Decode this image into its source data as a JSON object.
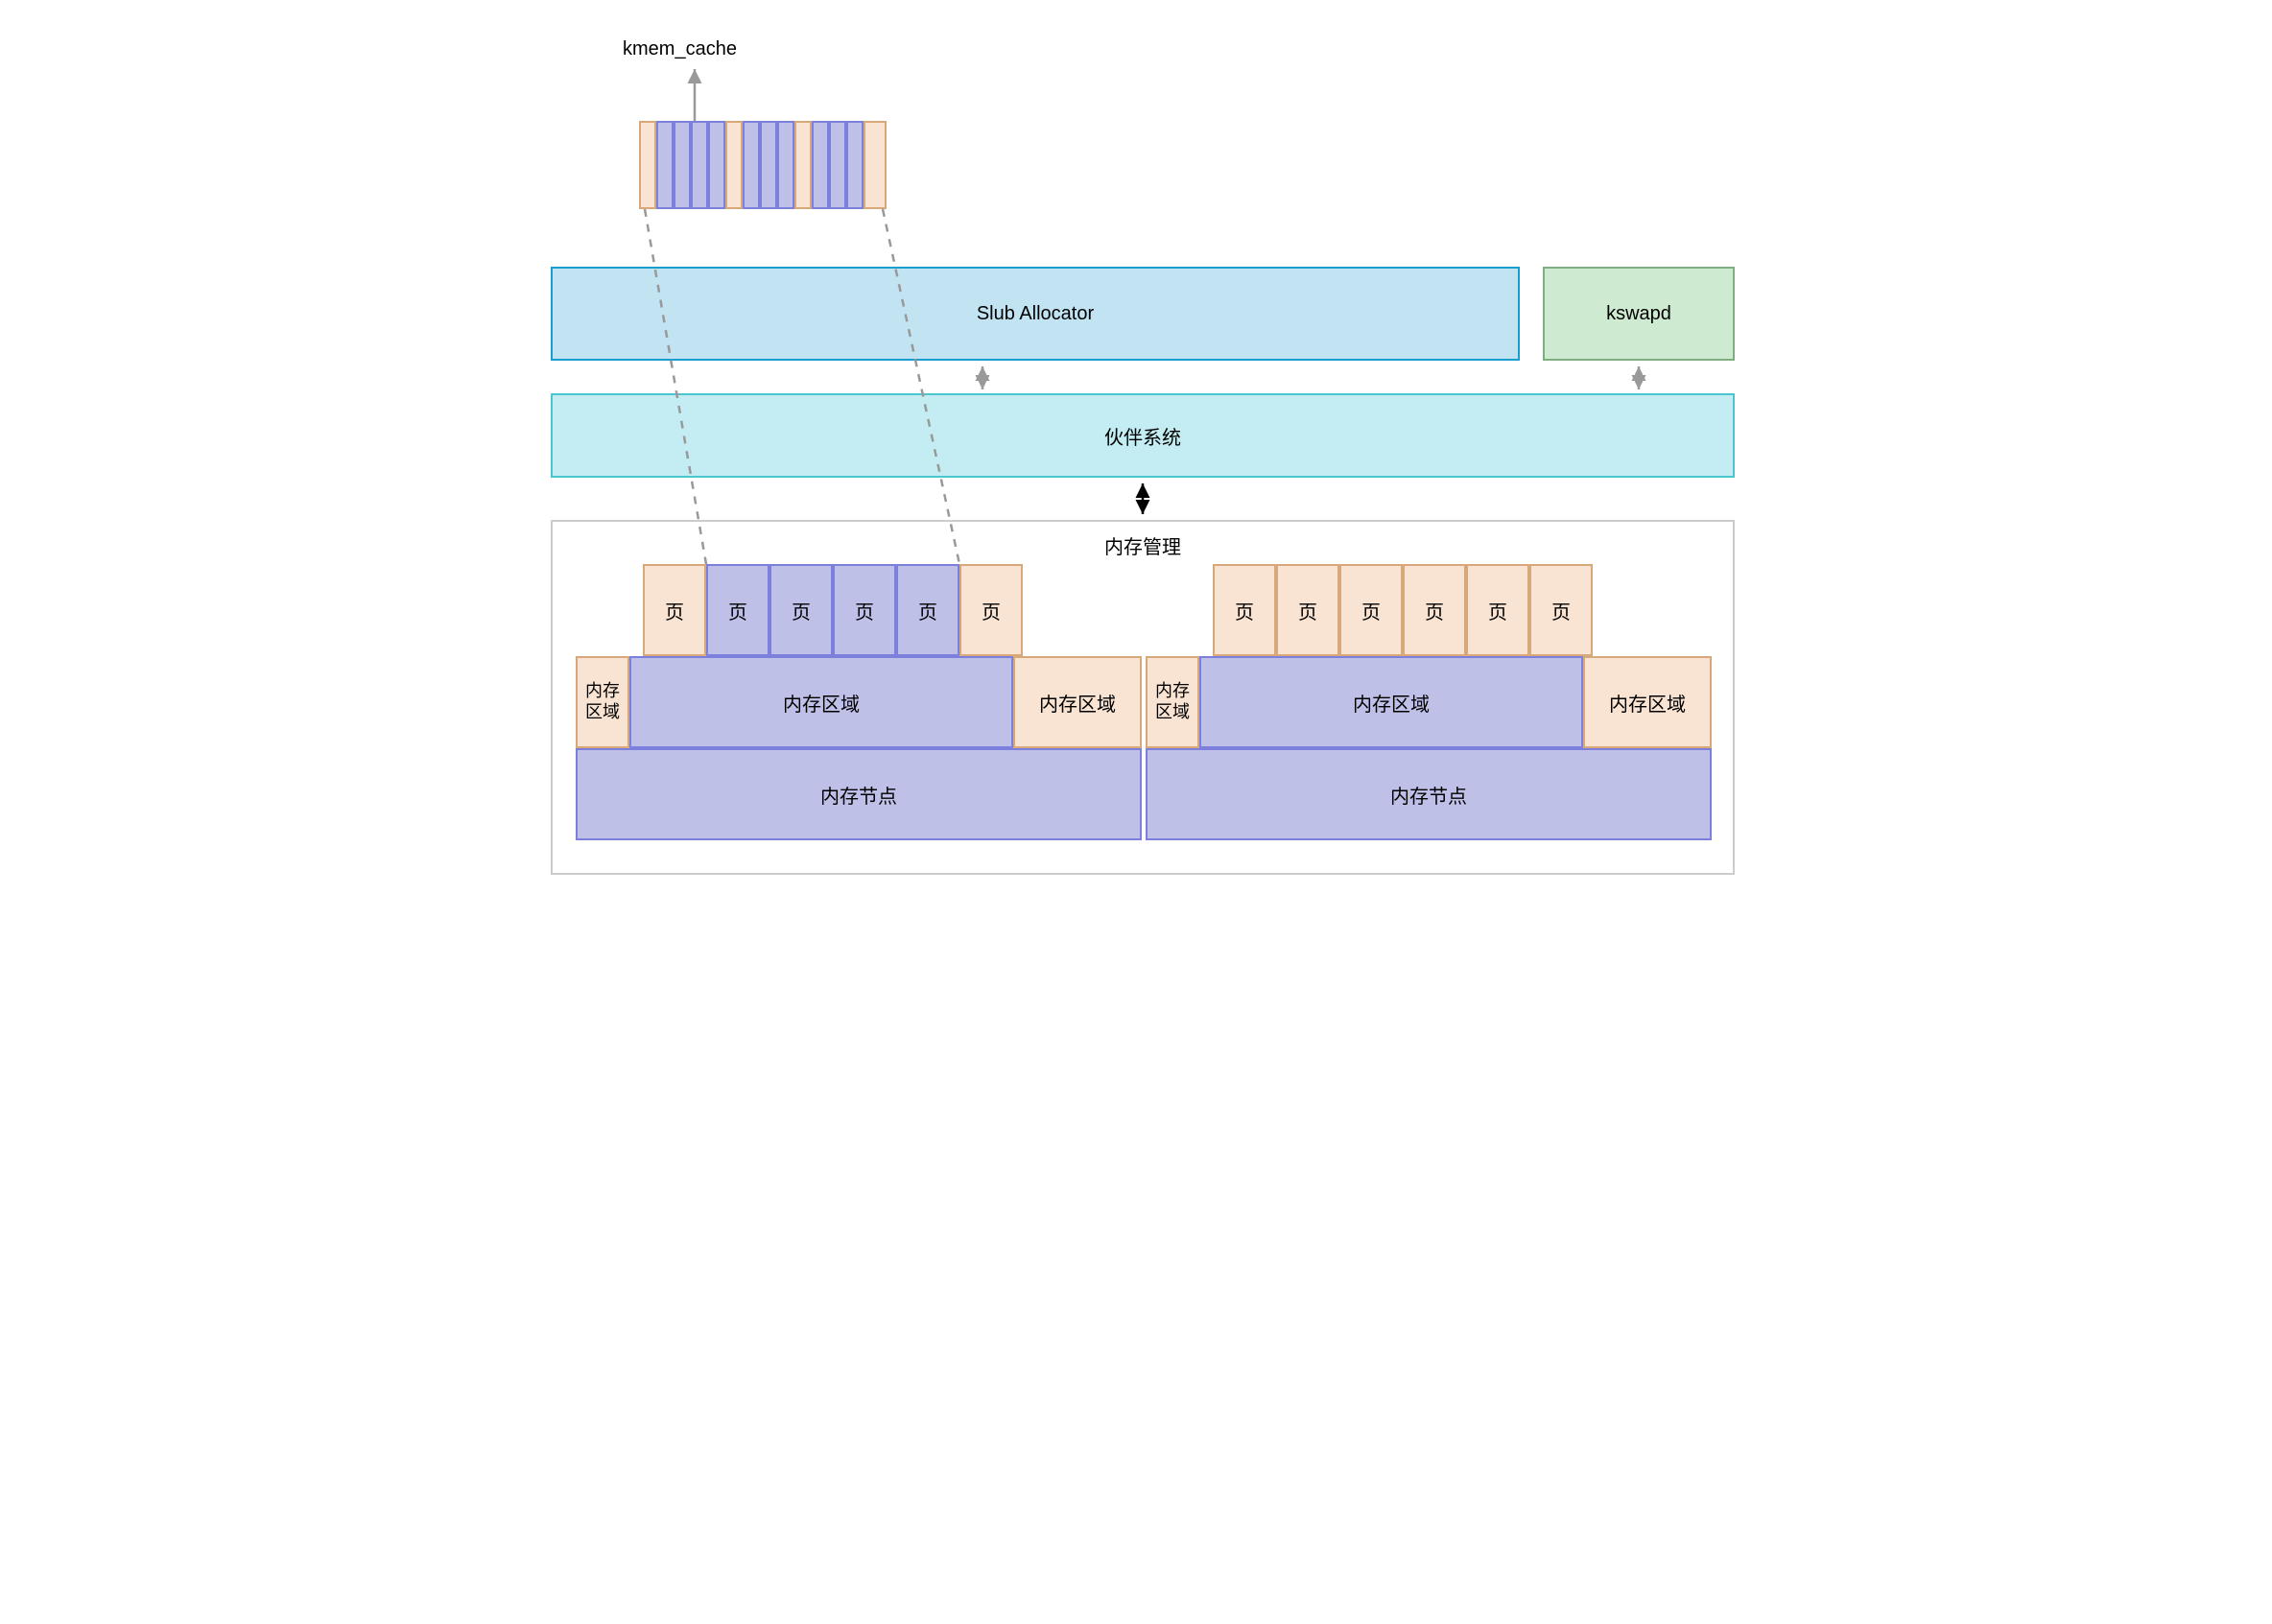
{
  "labels": {
    "kmem_cache": "kmem_cache",
    "slub": "Slub Allocator",
    "kswapd": "kswapd",
    "buddy": "伙伴系统",
    "mem_mgmt": "内存管理",
    "page": "页",
    "zone": "内存区域",
    "zone_small": "内存\n区域",
    "node": "内存节点"
  },
  "colors": {
    "peach_fill": "#f9e3d2",
    "peach_border": "#d7a97a",
    "purple_fill": "#bfc0e8",
    "purple_border": "#7c7fdc",
    "lightblue_fill": "#c1e3f2",
    "lightblue_border": "#1a9ed0",
    "cyan_fill": "#c3edf2",
    "cyan_border": "#4bc6d1",
    "green_fill": "#ceead0",
    "green_border": "#7fae82"
  }
}
